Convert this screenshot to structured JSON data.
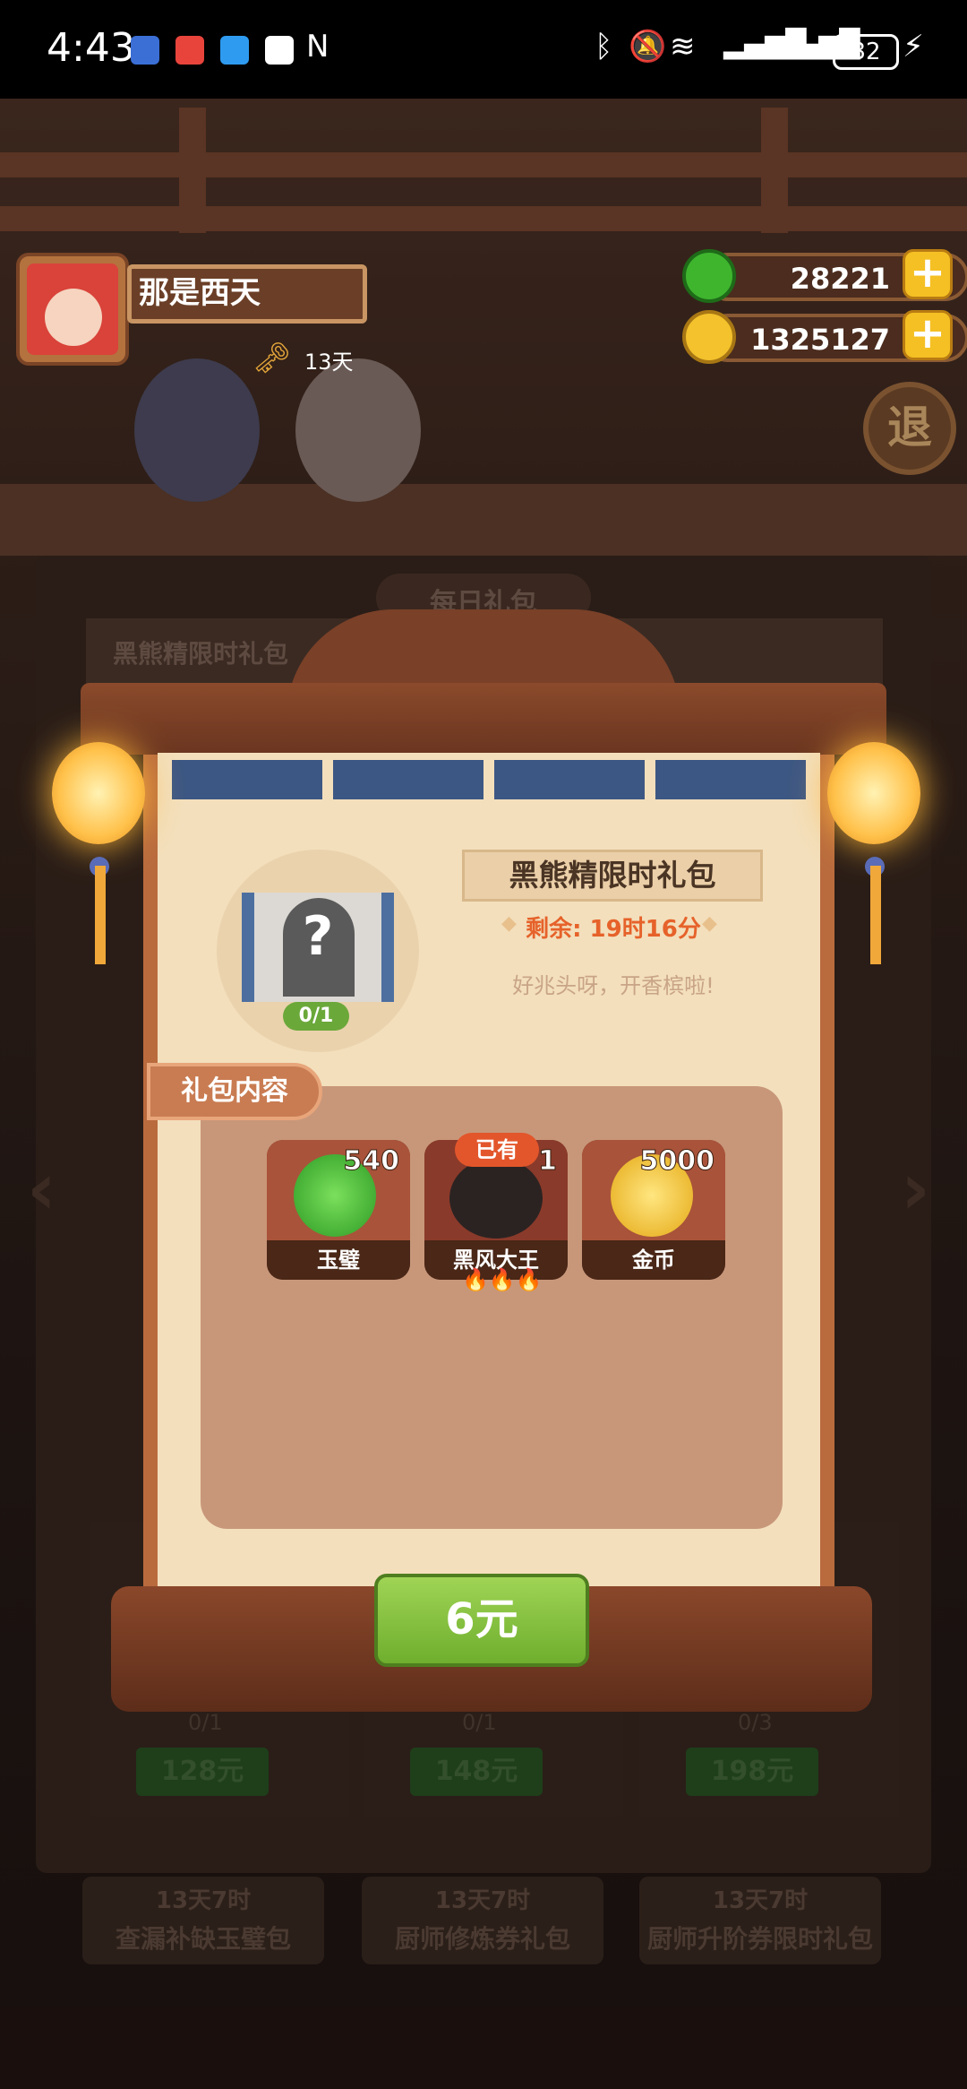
{
  "status_bar": {
    "time": "4:43",
    "battery": "32"
  },
  "hud": {
    "player_name": "那是西天",
    "days": "13天",
    "jade_amount": "28221",
    "gold_amount": "1325127",
    "plus_symbol": "+"
  },
  "background": {
    "daily_tab": "每日礼包",
    "list_header": "黑熊精限时礼包",
    "prices": [
      "128元",
      "148元",
      "198元"
    ],
    "progress": [
      "0/1",
      "0/1",
      "0/3"
    ],
    "bottom_tags": [
      {
        "timer": "13天7时",
        "name": "查漏补缺玉璧包"
      },
      {
        "timer": "13天7时",
        "name": "厨师修炼券礼包"
      },
      {
        "timer": "13天7时",
        "name": "厨师升阶券限时礼包"
      }
    ],
    "exit_label": "退"
  },
  "modal": {
    "title": "黑熊精限时礼包",
    "remaining": "剩余: 19时16分",
    "subtitle": "好兆头呀，开香槟啦!",
    "progress": "0/1",
    "contents_label": "礼包内容",
    "items": [
      {
        "name": "玉璧",
        "count": "540",
        "icon": "jade-disc-icon"
      },
      {
        "name": "黑风大王",
        "count": "1",
        "badge": "已有",
        "icon": "black-bear-icon",
        "stars": "🔥🔥🔥"
      },
      {
        "name": "金币",
        "count": "5000",
        "icon": "gold-coin-icon"
      }
    ],
    "buy_label": "6元"
  },
  "colors": {
    "accent_green": "#6fae2e",
    "timer_orange": "#e6622a",
    "gold": "#f5c024"
  }
}
